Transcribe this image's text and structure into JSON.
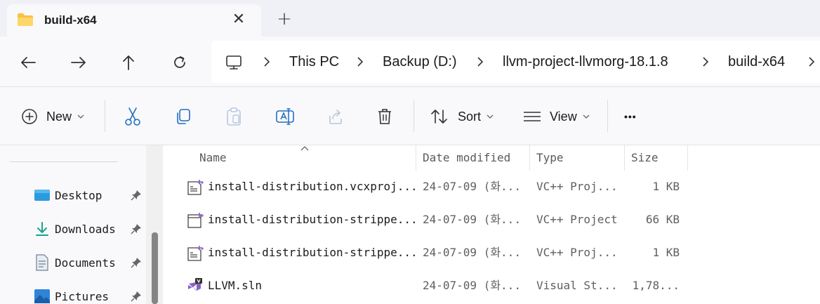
{
  "window": {
    "tab_title": "build-x64",
    "close_glyph": "✕",
    "new_tab_glyph": "+"
  },
  "nav_buttons": [
    "back-arrow-icon",
    "forward-arrow-icon",
    "up-arrow-icon",
    "refresh-icon"
  ],
  "address": {
    "crumbs": [
      "This PC",
      "Backup (D:)",
      "llvm-project-llvmorg-18.1.8",
      "build-x64"
    ]
  },
  "toolbar": {
    "new_label": "New",
    "sort_label": "Sort",
    "view_label": "View",
    "more_glyph": "•••"
  },
  "sidebar": {
    "items": [
      {
        "label": "Desktop",
        "icon": "desktop-icon"
      },
      {
        "label": "Downloads",
        "icon": "downloads-icon"
      },
      {
        "label": "Documents",
        "icon": "documents-icon"
      },
      {
        "label": "Pictures",
        "icon": "pictures-icon"
      }
    ]
  },
  "file_list": {
    "columns": {
      "name": "Name",
      "date": "Date modified",
      "type": "Type",
      "size": "Size"
    },
    "rows": [
      {
        "name": "install-distribution.vcxproj...",
        "date": "24-07-09 (화...",
        "type": "VC++ Proj...",
        "size": "1 KB",
        "icon": "vcxproj-filters-icon"
      },
      {
        "name": "install-distribution-strippe...",
        "date": "24-07-09 (화...",
        "type": "VC++ Project",
        "size": "66 KB",
        "icon": "vcxproj-icon"
      },
      {
        "name": "install-distribution-strippe...",
        "date": "24-07-09 (화...",
        "type": "VC++ Proj...",
        "size": "1 KB",
        "icon": "vcxproj-filters-icon"
      },
      {
        "name": "LLVM.sln",
        "date": "24-07-09 (화...",
        "type": "Visual St...",
        "size": "1,78...",
        "icon": "visual-studio-solution-icon"
      }
    ]
  },
  "colors": {
    "accent": "#0067c0",
    "chrome": "#eff1f6",
    "vs_purple": "#8661c5"
  }
}
